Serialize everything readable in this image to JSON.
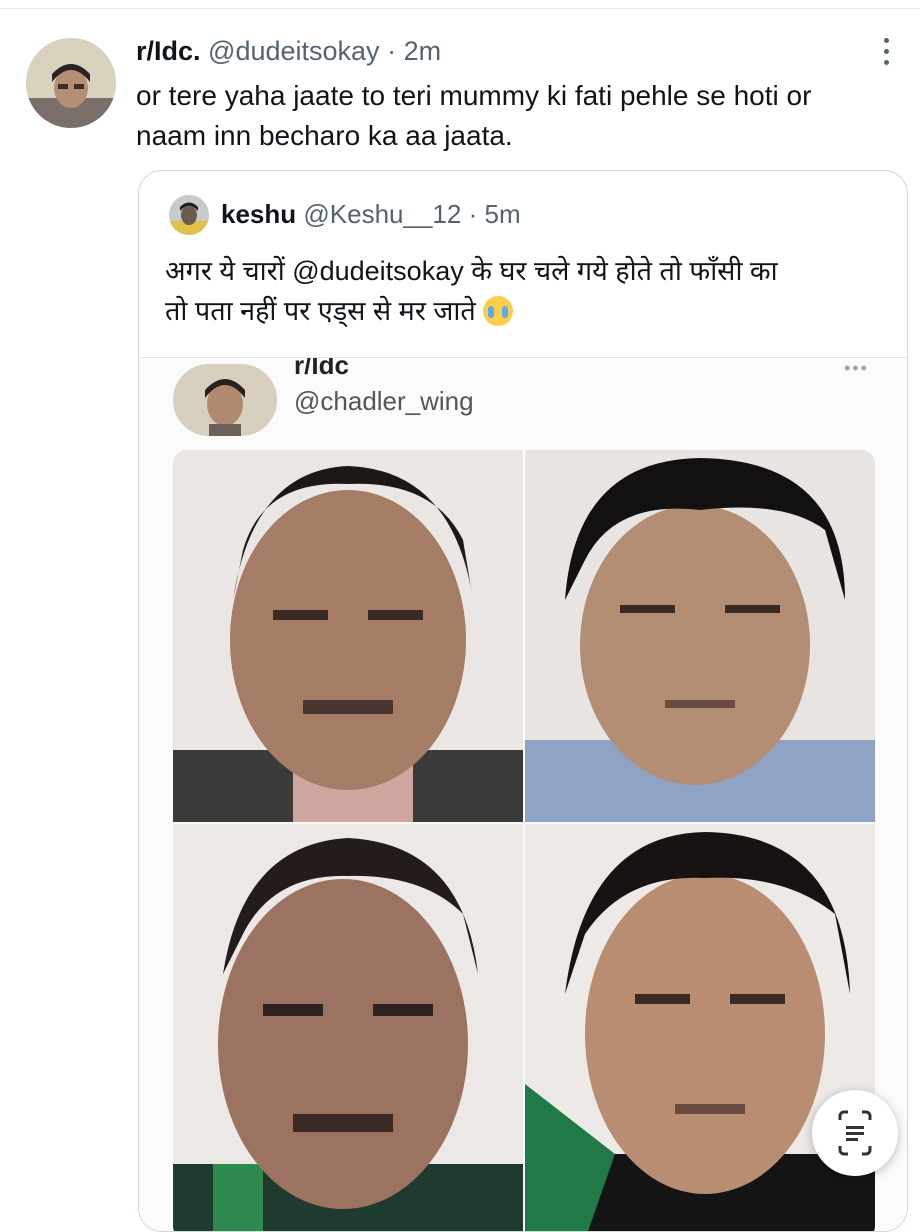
{
  "tweet": {
    "display_name": "r/Idc.",
    "handle": "@dudeitsokay",
    "separator": "·",
    "time": "2m",
    "text_line1": "or tere yaha jaate to teri mummy ki fati pehle se hoti or",
    "text_line2": "naam inn becharo ka aa jaata."
  },
  "quote": {
    "display_name": "keshu",
    "handle": "@Keshu__12",
    "separator": "·",
    "time": "5m",
    "text_line1": "अगर ये चारों @dudeitsokay के घर चले गये होते तो फाँसी का",
    "text_line2": "तो पता नहीं पर एड्स से मर जाते",
    "emoji": "crying-face-emoji"
  },
  "screenshot": {
    "top_name": "r/Idc",
    "handle": "@chadler_wing",
    "dots": "•••"
  },
  "icons": {
    "more": "more-vertical-icon",
    "lens": "google-lens-icon"
  },
  "colors": {
    "text": "#0f1419",
    "muted": "#536471",
    "border": "#cfd9de"
  }
}
